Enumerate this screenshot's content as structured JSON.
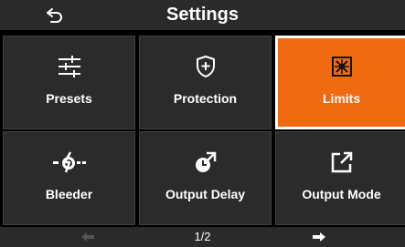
{
  "header": {
    "title": "Settings",
    "back_icon": "back-arrow-icon"
  },
  "tiles": [
    {
      "label": "Presets",
      "icon": "sliders-icon",
      "active": false
    },
    {
      "label": "Protection",
      "icon": "shield-plus-icon",
      "active": false
    },
    {
      "label": "Limits",
      "icon": "limits-icon",
      "active": true
    },
    {
      "label": "Bleeder",
      "icon": "bleeder-icon",
      "active": false
    },
    {
      "label": "Output Delay",
      "icon": "output-delay-icon",
      "active": false
    },
    {
      "label": "Output Mode",
      "icon": "output-mode-icon",
      "active": false
    }
  ],
  "footer": {
    "page_indicator": "1/2",
    "prev_icon": "arrow-left-icon",
    "next_icon": "arrow-right-icon",
    "prev_enabled": false,
    "next_enabled": true
  },
  "colors": {
    "background": "#000000",
    "tile": "#2b2b2b",
    "accent": "#f06a12",
    "header": "#2a2a2a",
    "disabled": "#555555"
  }
}
